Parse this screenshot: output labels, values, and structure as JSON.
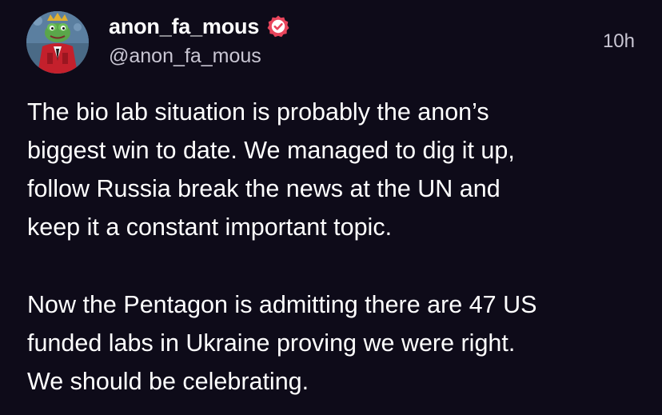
{
  "post": {
    "display_name": "anon_fa_mous",
    "handle": "@anon_fa_mous",
    "timestamp": "10h",
    "verified_icon": "verified-badge-icon",
    "avatar_icon": "frog-avatar-icon",
    "paragraphs": [
      "The bio lab situation is probably the anon’s\nbiggest win to date. We managed to dig it up,\nfollow Russia break the news at the UN and\nkeep it a constant important topic.",
      "Now the Pentagon is admitting there are 47 US\nfunded labs in Ukraine proving we were right.\nWe should be celebrating."
    ]
  },
  "colors": {
    "background": "#0e0b19",
    "text": "#ffffff",
    "secondary_text": "#c9c6d3",
    "verified_badge": "#e8455c"
  }
}
